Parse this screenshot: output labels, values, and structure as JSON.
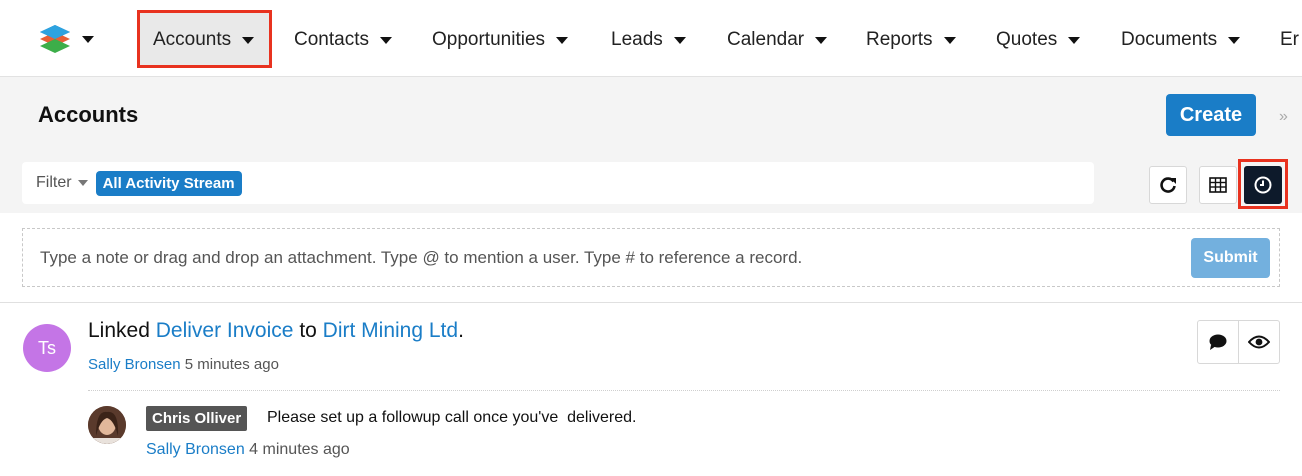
{
  "nav": {
    "items": [
      {
        "label": "Accounts"
      },
      {
        "label": "Contacts"
      },
      {
        "label": "Opportunities"
      },
      {
        "label": "Leads"
      },
      {
        "label": "Calendar"
      },
      {
        "label": "Reports"
      },
      {
        "label": "Quotes"
      },
      {
        "label": "Documents"
      },
      {
        "label": "Er"
      }
    ],
    "active_item": "Accounts"
  },
  "header": {
    "title": "Accounts",
    "create_label": "Create"
  },
  "filter": {
    "label": "Filter",
    "pill": "All Activity Stream"
  },
  "view_buttons": {
    "refresh_icon": "refresh-icon",
    "list_icon": "table-icon",
    "activity_icon": "clock-icon",
    "active": "activity-stream"
  },
  "composer": {
    "placeholder": "Type a note or drag and drop an attachment. Type @ to mention a user. Type # to reference a record.",
    "submit_label": "Submit"
  },
  "activity": {
    "avatar_initials": "Ts",
    "verb": "Linked",
    "record": "Deliver Invoice",
    "connector": "to",
    "target": "Dirt Mining Ltd",
    "end": ".",
    "author": "Sally Bronsen",
    "time": "5 minutes ago",
    "comment": {
      "mention": "Chris Olliver",
      "text": "Please set up a followup call once you've  delivered.",
      "author": "Sally Bronsen",
      "time": "4 minutes ago"
    }
  },
  "colors": {
    "accent": "#1a7dc7",
    "highlight": "#e8321f",
    "avatar": "#c475e6"
  }
}
